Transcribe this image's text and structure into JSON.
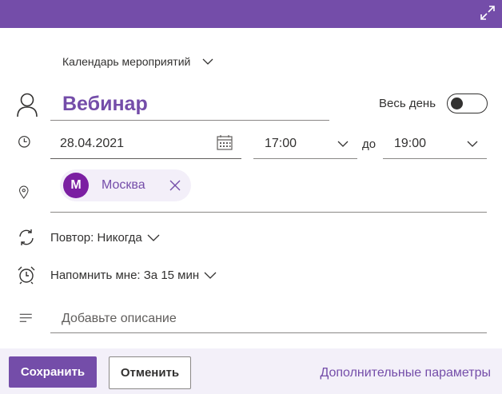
{
  "theme": {
    "accent": "#744DA9",
    "avatar_color": "#7B1FA2",
    "footer_bg": "#f3f0f9"
  },
  "header": {
    "expand_icon": "expand-icon"
  },
  "calendar": {
    "name": "Календарь мероприятий"
  },
  "event": {
    "title": "Вебинар",
    "all_day_label": "Весь день",
    "all_day": false
  },
  "datetime": {
    "date": "28.04.2021",
    "start_time": "17:00",
    "to_label": "до",
    "end_time": "19:00"
  },
  "location": {
    "avatar_initial": "М",
    "name": "Москва"
  },
  "repeat": {
    "label": "Повтор:",
    "value": "Никогда"
  },
  "reminder": {
    "label": "Напомнить мне:",
    "value": "За 15 мин"
  },
  "description": {
    "placeholder": "Добавьте описание"
  },
  "footer": {
    "save_label": "Сохранить",
    "cancel_label": "Отменить",
    "more_options_label": "Дополнительные параметры"
  }
}
